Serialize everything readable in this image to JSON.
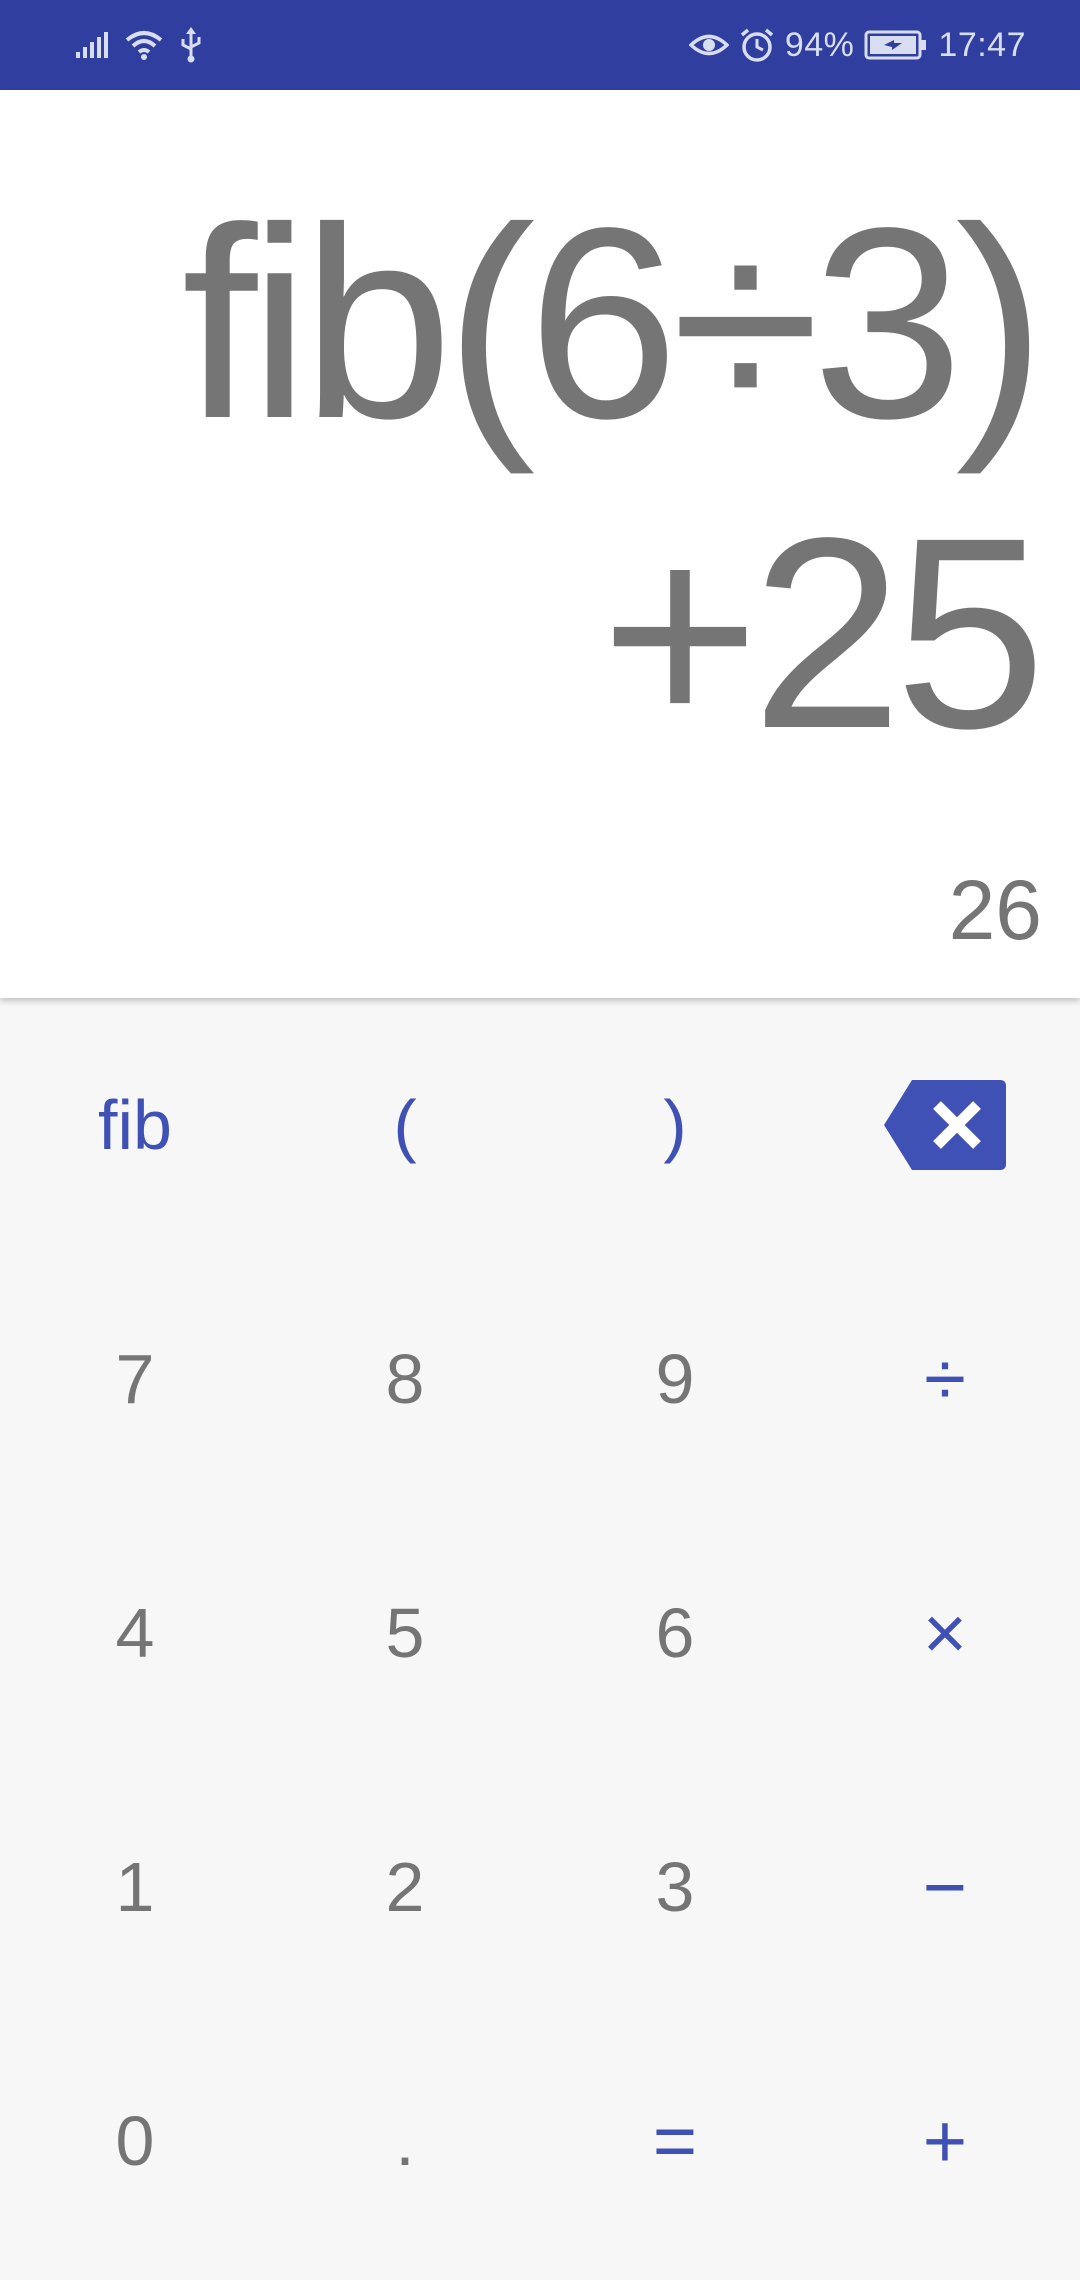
{
  "status_bar": {
    "battery_percent": "94%",
    "time": "17:47",
    "icons": [
      "signal-icon",
      "wifi-icon",
      "usb-icon",
      "eye-comfort-icon",
      "alarm-icon",
      "battery-charging-icon"
    ]
  },
  "display": {
    "formula_line1": "fib(6÷3)",
    "formula_line2": "+25",
    "result": "26"
  },
  "keypad": {
    "row1": {
      "fib": "fib",
      "open_paren": "(",
      "close_paren": ")",
      "delete_icon": "backspace-icon"
    },
    "row2": {
      "k7": "7",
      "k8": "8",
      "k9": "9",
      "divide": "÷"
    },
    "row3": {
      "k4": "4",
      "k5": "5",
      "k6": "6",
      "multiply": "×"
    },
    "row4": {
      "k1": "1",
      "k2": "2",
      "k3": "3",
      "minus": "−"
    },
    "row5": {
      "k0": "0",
      "dot": ".",
      "equals": "=",
      "plus": "+"
    }
  },
  "colors": {
    "status_bar": "#303f9f",
    "accent": "#3f51b5",
    "digit_text": "#757575",
    "display_bg": "#ffffff",
    "keypad_bg": "#f7f7f7"
  }
}
